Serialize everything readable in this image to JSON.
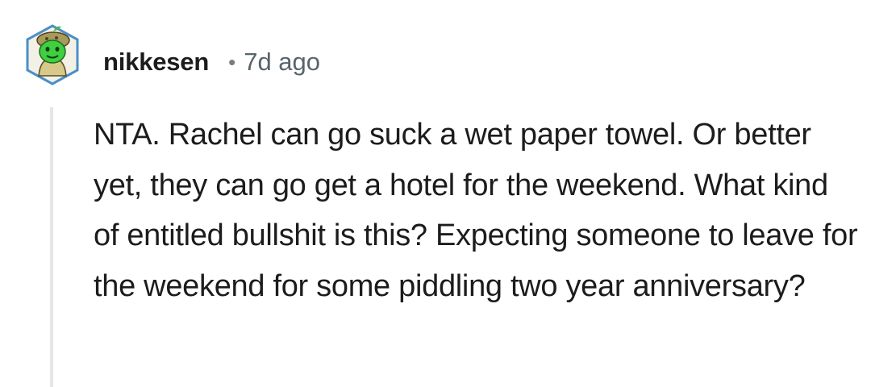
{
  "comment": {
    "author": {
      "username": "nikkesen",
      "avatar_icon": "snoo-avatar-icon"
    },
    "separator": "•",
    "timestamp": "7d ago",
    "body": "NTA. Rachel can go suck a wet paper towel. Or better yet, they can go get a hotel for the weekend. What kind of entitled bullshit is this? Expecting someone to leave for the weekend for some piddling two year anniversary?"
  },
  "colors": {
    "text": "#1c1c1c",
    "meta": "#58646b",
    "thread_line": "#e6e6e6",
    "avatar_green": "#3fcf3f",
    "avatar_hex_border": "#4a8fc7"
  }
}
